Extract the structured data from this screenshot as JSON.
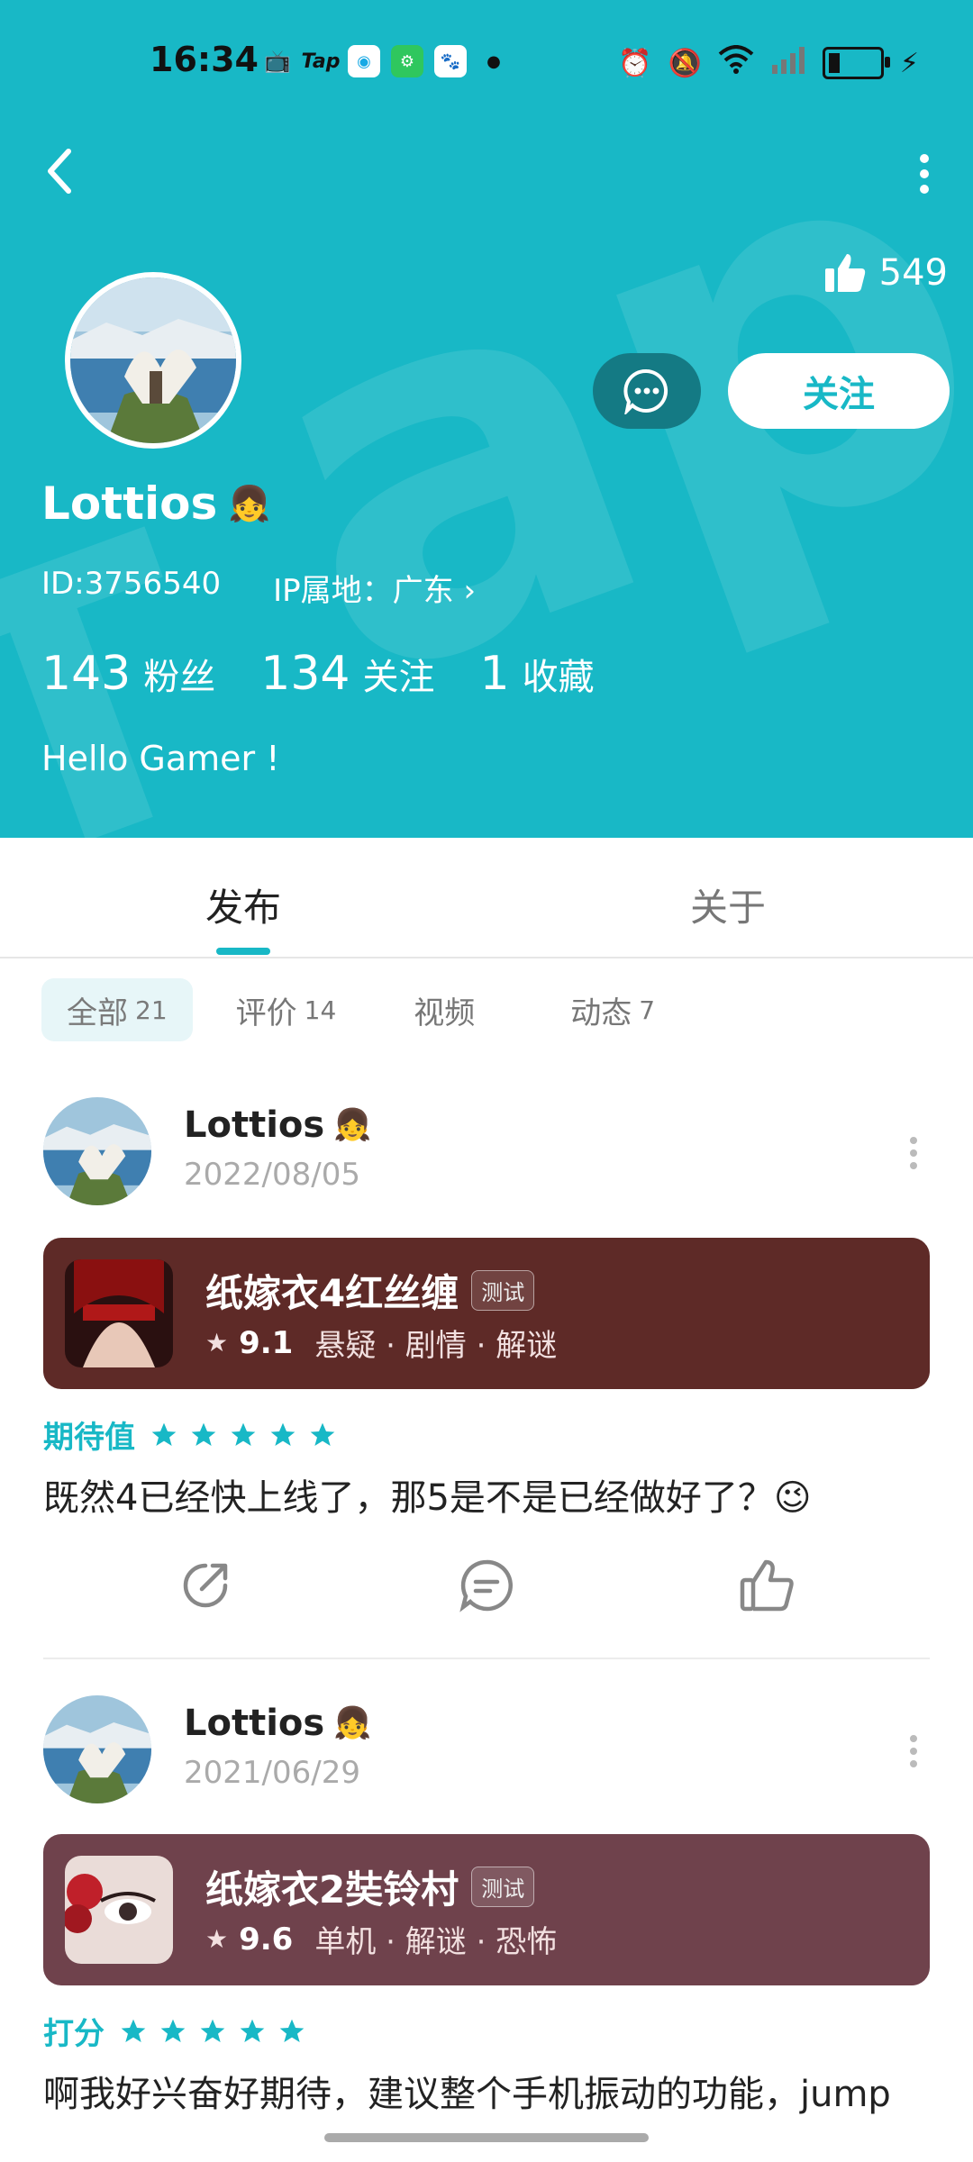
{
  "status_bar": {
    "time": "16:34",
    "tap": "Tap"
  },
  "header": {
    "likes": "549",
    "follow_label": "关注",
    "username": "Lottios",
    "id": "ID:3756540",
    "ip": "IP属地：广东",
    "bio": "Hello Gamer !",
    "stats": [
      {
        "num": "143",
        "label": "粉丝"
      },
      {
        "num": "134",
        "label": "关注"
      },
      {
        "num": "1",
        "label": "收藏"
      }
    ],
    "bg_color": "#18b8c6"
  },
  "tabs": [
    {
      "label": "发布",
      "active": true
    },
    {
      "label": "关于",
      "active": false
    }
  ],
  "filters": [
    {
      "label": "全部",
      "count": "21",
      "active": true
    },
    {
      "label": "评价",
      "count": "14",
      "active": false
    },
    {
      "label": "视频",
      "count": "",
      "active": false
    },
    {
      "label": "动态",
      "count": "7",
      "active": false
    }
  ],
  "posts": [
    {
      "author": "Lottios",
      "date": "2022/08/05",
      "game": {
        "title": "纸嫁衣4红丝缠",
        "tag": "测试",
        "score": "9.1",
        "genres": "悬疑 · 剧情 · 解谜",
        "bg": "#5e2a27"
      },
      "rating_label": "期待值",
      "stars": 5,
      "text": "既然4已经快上线了，那5是不是已经做好了？😉"
    },
    {
      "author": "Lottios",
      "date": "2021/06/29",
      "game": {
        "title": "纸嫁衣2奘铃村",
        "tag": "测试",
        "score": "9.6",
        "genres": "单机 · 解谜 · 恐怖",
        "bg": "#6f424c"
      },
      "rating_label": "打分",
      "stars": 5,
      "text": "啊我好兴奋好期待，建议整个手机振动的功能，jump"
    }
  ]
}
